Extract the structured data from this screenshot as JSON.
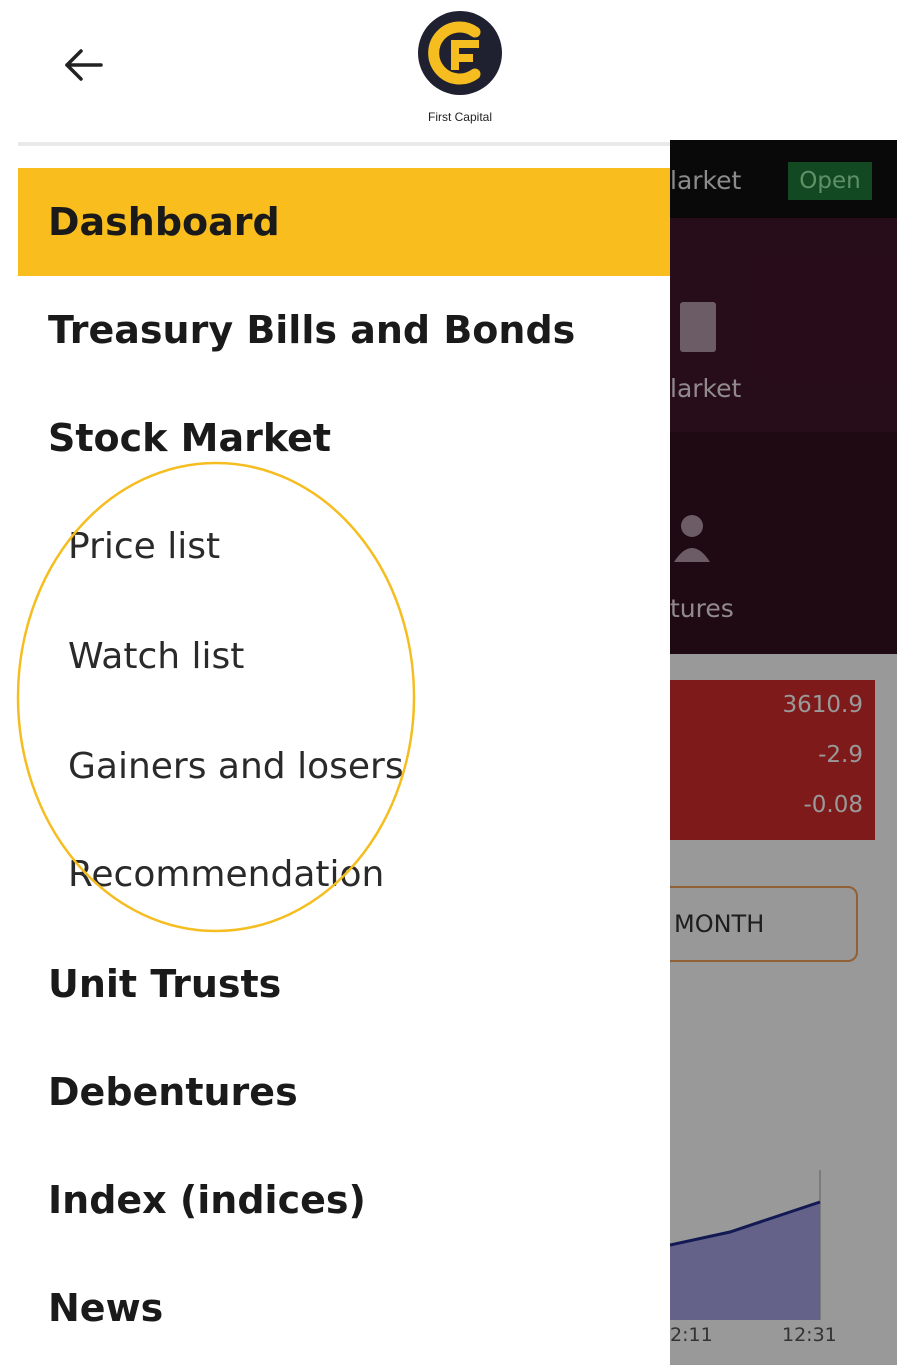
{
  "header": {
    "back_icon": "arrow-left-icon",
    "logo_text": "First Capital",
    "logo_colors": {
      "circle": "#1f2130",
      "mark": "#f5bd1f"
    }
  },
  "drawer": {
    "active_color": "#f9bd1e",
    "items": [
      {
        "label": "Dashboard",
        "level": "top",
        "active": true
      },
      {
        "label": "Treasury Bills and Bonds",
        "level": "top"
      },
      {
        "label": "Stock Market",
        "level": "top"
      },
      {
        "label": "Price list",
        "level": "sub"
      },
      {
        "label": "Watch list",
        "level": "sub"
      },
      {
        "label": "Gainers and losers",
        "level": "sub"
      },
      {
        "label": "Recommendation",
        "level": "sub"
      },
      {
        "label": "Unit Trusts",
        "level": "top"
      },
      {
        "label": "Debentures",
        "level": "top"
      },
      {
        "label": "Index (indices)",
        "level": "top"
      },
      {
        "label": "News",
        "level": "top"
      }
    ]
  },
  "annotation": {
    "color": "#f5bd1f",
    "target": "stock-market-submenu"
  },
  "background_app": {
    "market_label": "larket",
    "status_badge": "Open",
    "market_label_2": "larket",
    "tab_label": "tures",
    "index": {
      "value": "3610.9",
      "change": "-2.9",
      "percent": "-0.08"
    },
    "range_button": "MONTH",
    "time_labels": [
      "2:11",
      "12:31"
    ]
  }
}
